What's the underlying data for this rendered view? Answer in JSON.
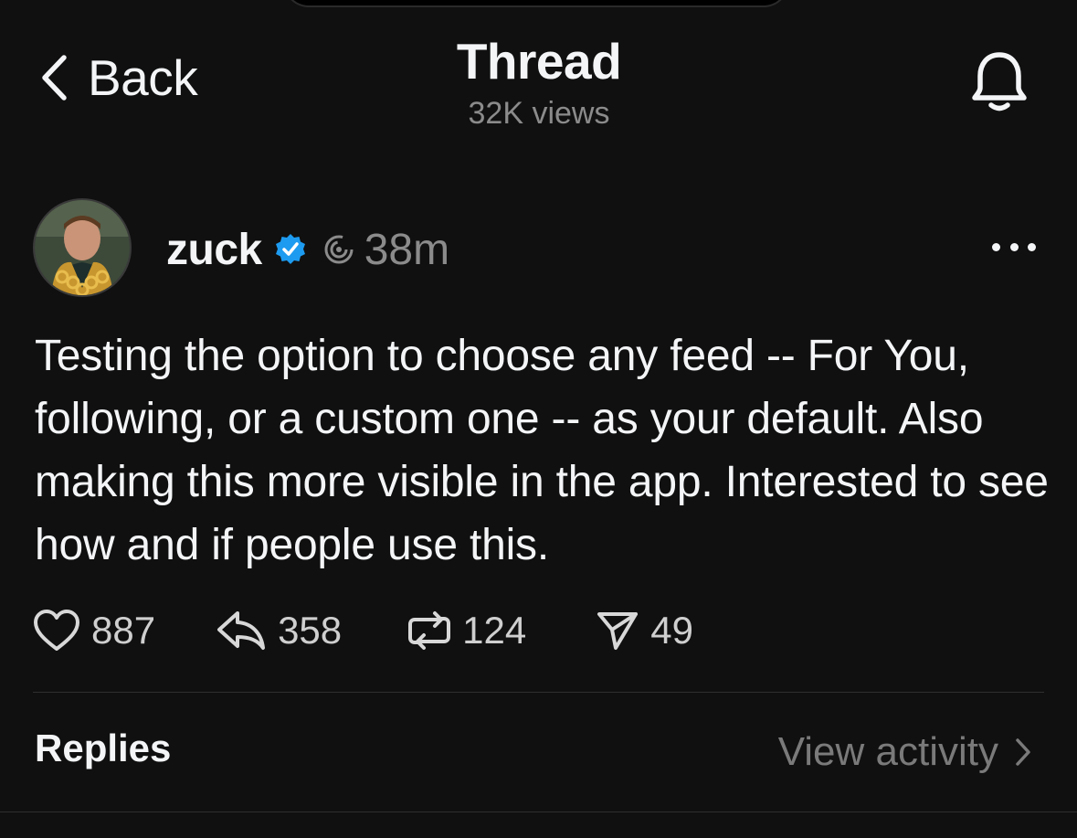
{
  "header": {
    "back_label": "Back",
    "title": "Thread",
    "subtitle": "32K views",
    "bell_icon": "bell-icon"
  },
  "post": {
    "username": "zuck",
    "verified": true,
    "timestamp": "38m",
    "text": "Testing the option to choose any feed -- For You, following, or a custom one -- as your default. Also making this more visible in the app. Interested to see how and if people use this.",
    "actions": {
      "likes": "887",
      "replies": "358",
      "reposts": "124",
      "shares": "49"
    }
  },
  "footer": {
    "replies_label": "Replies",
    "view_activity_label": "View activity"
  },
  "colors": {
    "background": "#101010",
    "text_primary": "#f3f5f7",
    "text_secondary": "#8b8b8b",
    "verified_blue": "#1d9bf0"
  }
}
